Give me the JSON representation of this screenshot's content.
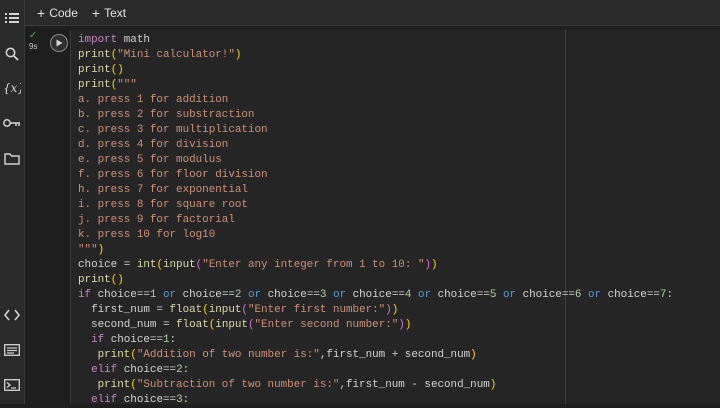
{
  "toolbar": {
    "code_label": "Code",
    "text_label": "Text"
  },
  "cell": {
    "exec_status": "✓",
    "exec_time": "9s"
  },
  "sidebar": {
    "top_icons": [
      "menu-icon",
      "search-icon",
      "variables-icon",
      "key-icon",
      "folder-icon"
    ],
    "bottom_icons": [
      "code-brackets-icon",
      "command-palette-icon",
      "terminal-icon"
    ]
  },
  "code_lines": [
    [
      [
        "kw",
        "import"
      ],
      [
        "",
        " math"
      ]
    ],
    [
      [
        "fn",
        "print"
      ],
      [
        "br1",
        "("
      ],
      [
        "str",
        "\"Mini calculator!\""
      ],
      [
        "br1",
        ")"
      ]
    ],
    [
      [
        "fn",
        "print"
      ],
      [
        "br1",
        "()"
      ]
    ],
    [
      [
        "fn",
        "print"
      ],
      [
        "br1",
        "("
      ],
      [
        "str",
        "\"\"\""
      ]
    ],
    [
      [
        "str",
        "a. press 1 for addition"
      ]
    ],
    [
      [
        "str",
        "b. press 2 for substraction"
      ]
    ],
    [
      [
        "str",
        "c. press 3 for multiplication"
      ]
    ],
    [
      [
        "str",
        "d. press 4 for division"
      ]
    ],
    [
      [
        "str",
        "e. press 5 for modulus"
      ]
    ],
    [
      [
        "str",
        "f. press 6 for floor division"
      ]
    ],
    [
      [
        "str",
        "h. press 7 for exponential"
      ]
    ],
    [
      [
        "str",
        "i. press 8 for square root"
      ]
    ],
    [
      [
        "str",
        "j. press 9 for factorial"
      ]
    ],
    [
      [
        "str",
        "k. press 10 for log10"
      ]
    ],
    [
      [
        "str",
        "\"\"\""
      ],
      [
        "br1",
        ")"
      ]
    ],
    [
      [
        "",
        "choice = "
      ],
      [
        "fn",
        "int"
      ],
      [
        "br1",
        "("
      ],
      [
        "fn",
        "input"
      ],
      [
        "br2",
        "("
      ],
      [
        "str",
        "\"Enter any integer from 1 to 10: \""
      ],
      [
        "br2",
        ")"
      ],
      [
        "br1",
        ")"
      ]
    ],
    [
      [
        "fn",
        "print"
      ],
      [
        "br1",
        "()"
      ]
    ],
    [
      [
        "kw",
        "if"
      ],
      [
        "",
        " choice=="
      ],
      [
        "num",
        "1"
      ],
      [
        "",
        " "
      ],
      [
        "op",
        "or"
      ],
      [
        "",
        " choice=="
      ],
      [
        "num",
        "2"
      ],
      [
        "",
        " "
      ],
      [
        "op",
        "or"
      ],
      [
        "",
        " choice=="
      ],
      [
        "num",
        "3"
      ],
      [
        "",
        " "
      ],
      [
        "op",
        "or"
      ],
      [
        "",
        " choice=="
      ],
      [
        "num",
        "4"
      ],
      [
        "",
        " "
      ],
      [
        "op",
        "or"
      ],
      [
        "",
        " choice=="
      ],
      [
        "num",
        "5"
      ],
      [
        "",
        " "
      ],
      [
        "op",
        "or"
      ],
      [
        "",
        " choice=="
      ],
      [
        "num",
        "6"
      ],
      [
        "",
        " "
      ],
      [
        "op",
        "or"
      ],
      [
        "",
        " choice=="
      ],
      [
        "num",
        "7"
      ],
      [
        "",
        ":"
      ]
    ],
    [
      [
        "",
        "  first_num = "
      ],
      [
        "fn",
        "float"
      ],
      [
        "br1",
        "("
      ],
      [
        "fn",
        "input"
      ],
      [
        "br2",
        "("
      ],
      [
        "str",
        "\"Enter first number:\""
      ],
      [
        "br2",
        ")"
      ],
      [
        "br1",
        ")"
      ]
    ],
    [
      [
        "",
        "  second_num = "
      ],
      [
        "fn",
        "float"
      ],
      [
        "br1",
        "("
      ],
      [
        "fn",
        "input"
      ],
      [
        "br2",
        "("
      ],
      [
        "str",
        "\"Enter second number:\""
      ],
      [
        "br2",
        ")"
      ],
      [
        "br1",
        ")"
      ]
    ],
    [
      [
        "",
        "  "
      ],
      [
        "kw",
        "if"
      ],
      [
        "",
        " choice=="
      ],
      [
        "num",
        "1"
      ],
      [
        "",
        ":"
      ]
    ],
    [
      [
        "",
        "   "
      ],
      [
        "fn",
        "print"
      ],
      [
        "br1",
        "("
      ],
      [
        "str",
        "\"Addition of two number is:\""
      ],
      [
        "",
        ",first_num + second_num"
      ],
      [
        "br1",
        ")"
      ]
    ],
    [
      [
        "",
        "  "
      ],
      [
        "kw",
        "elif"
      ],
      [
        "",
        " choice=="
      ],
      [
        "num",
        "2"
      ],
      [
        "",
        ":"
      ]
    ],
    [
      [
        "",
        "   "
      ],
      [
        "fn",
        "print"
      ],
      [
        "br1",
        "("
      ],
      [
        "str",
        "\"Subtraction of two number is:\""
      ],
      [
        "",
        ",first_num - second_num"
      ],
      [
        "br1",
        ")"
      ]
    ],
    [
      [
        "",
        "  "
      ],
      [
        "kw",
        "elif"
      ],
      [
        "",
        " choice=="
      ],
      [
        "num",
        "3"
      ],
      [
        "",
        ":"
      ]
    ]
  ],
  "colors": {
    "keyword": "#c586c0",
    "operator": "#569cd6",
    "function": "#dcdcaa",
    "string": "#ce9178",
    "number": "#b5cea8",
    "bracket1": "#ffd700",
    "bracket2": "#da70d6",
    "success": "#4caf50"
  }
}
